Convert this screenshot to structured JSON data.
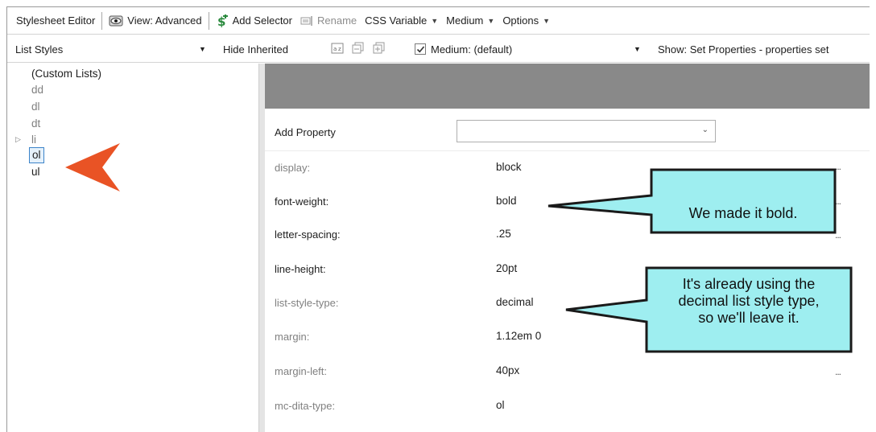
{
  "toolbar": {
    "title": "Stylesheet Editor",
    "view_label": "View: Advanced",
    "add_selector_label": "Add Selector",
    "rename_label": "Rename",
    "css_variable_label": "CSS Variable",
    "medium_label": "Medium",
    "options_label": "Options"
  },
  "filterbar": {
    "list_styles_value": "List Styles",
    "hide_inherited_label": "Hide Inherited",
    "medium_value": "Medium: (default)",
    "show_value": "Show: Set Properties - properties set"
  },
  "tree": {
    "items": [
      {
        "label": "(Custom Lists)",
        "dim": false
      },
      {
        "label": "dd",
        "dim": true
      },
      {
        "label": "dl",
        "dim": true
      },
      {
        "label": "dt",
        "dim": true
      },
      {
        "label": "li",
        "dim": true
      },
      {
        "label": "ol",
        "dim": false,
        "selected": true
      },
      {
        "label": "ul",
        "dim": false
      }
    ]
  },
  "properties": {
    "add_property_label": "Add Property",
    "add_property_value": "",
    "rows": [
      {
        "name": "display:",
        "value": "block",
        "dim": true,
        "more": "..."
      },
      {
        "name": "font-weight:",
        "value": "bold",
        "dim": false,
        "more": "..."
      },
      {
        "name": "letter-spacing:",
        "value": ".25",
        "dim": false,
        "more": "..."
      },
      {
        "name": "line-height:",
        "value": "20pt",
        "dim": false,
        "more": ""
      },
      {
        "name": "list-style-type:",
        "value": "decimal",
        "dim": true,
        "more": ""
      },
      {
        "name": "margin:",
        "value": "1.12em 0",
        "dim": true,
        "more": ""
      },
      {
        "name": "margin-left:",
        "value": "40px",
        "dim": true,
        "more": "..."
      },
      {
        "name": "mc-dita-type:",
        "value": "ol",
        "dim": true,
        "more": ""
      }
    ]
  },
  "callouts": {
    "bold": "We made it bold.",
    "decimal_line1": "It's already using the",
    "decimal_line2": "decimal list style type,",
    "decimal_line3": "so we'll leave it."
  },
  "colors": {
    "callout_fill": "#9eeef0",
    "arrow_fill": "#e95325",
    "selection": "#3c84c9",
    "header_band": "#898989"
  }
}
